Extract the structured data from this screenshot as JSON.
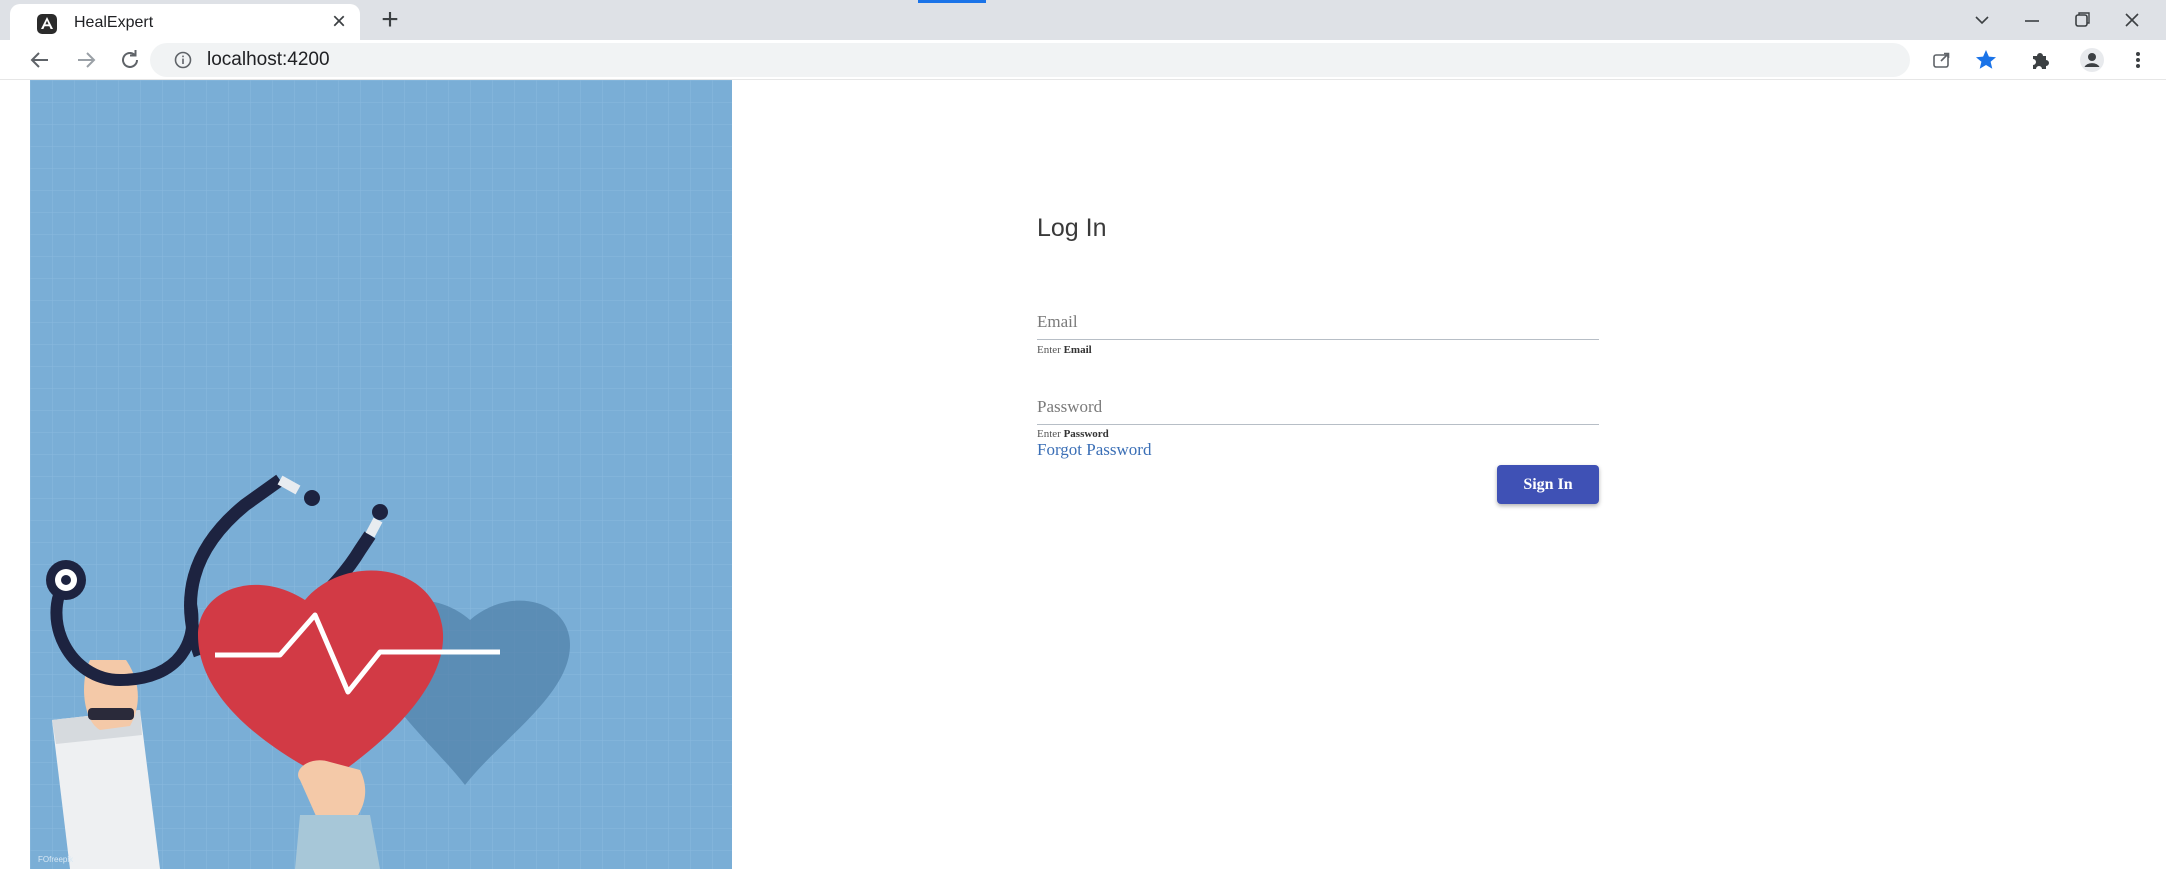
{
  "browser": {
    "tab_title": "HealExpert",
    "new_tab_icon": "plus-icon",
    "url": "localhost:4200",
    "accent_color": "#1a73e8"
  },
  "login": {
    "title": "Log In",
    "email_placeholder": "Email",
    "email_hint_prefix": "Enter",
    "email_hint_bold": "Email",
    "password_placeholder": "Password",
    "password_hint_prefix": "Enter",
    "password_hint_bold": "Password",
    "forgot_label": "Forgot Password",
    "signin_label": "Sign In",
    "button_color": "#3f51b5"
  },
  "hero": {
    "background_color": "#7aaed6",
    "heart_color": "#d23a45",
    "illustration": "stethoscope-heart-illustration"
  }
}
